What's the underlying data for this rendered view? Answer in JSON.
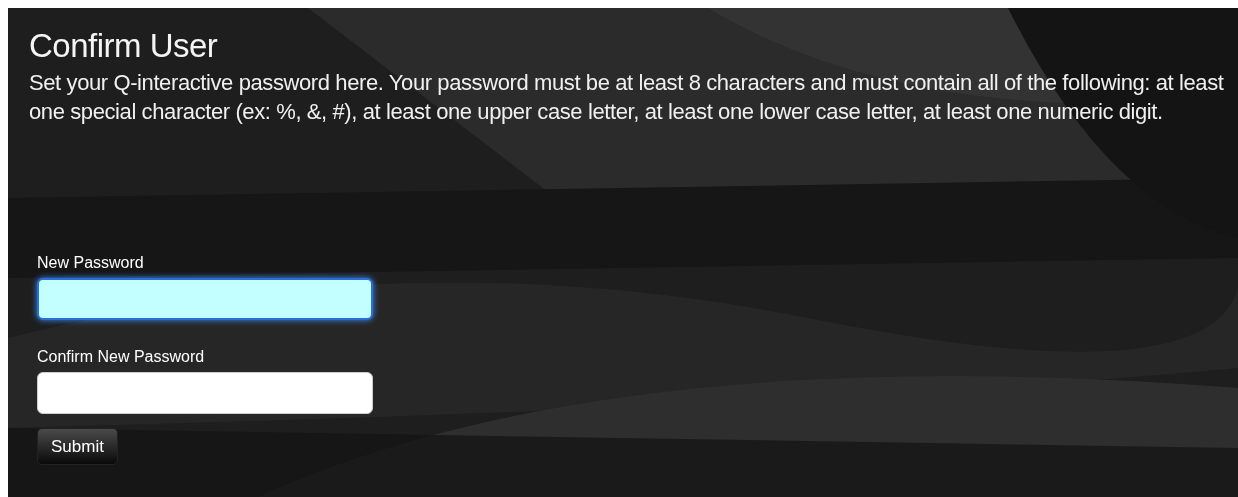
{
  "title": "Confirm User",
  "description": "Set your Q-interactive password here. Your password must be at least 8 characters and must contain all of the following: at least one special character (ex: %, &, #), at least one upper case letter, at least one lower case letter, at least one numeric digit.",
  "fields": [
    {
      "label": "New Password",
      "focused": true
    },
    {
      "label": "Confirm New Password",
      "focused": false
    }
  ],
  "submit_button": "Submit"
}
